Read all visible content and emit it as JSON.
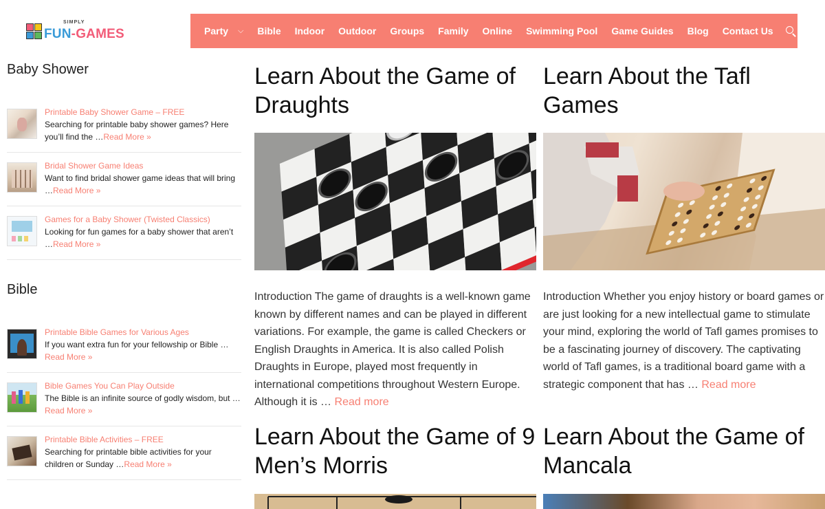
{
  "logo": {
    "simply": "SIMPLY",
    "fun": "FUN",
    "dash": "-",
    "games": "GAMES"
  },
  "nav": {
    "items": [
      "Party",
      "Bible",
      "Indoor",
      "Outdoor",
      "Groups",
      "Family",
      "Online",
      "Swimming Pool",
      "Game Guides",
      "Blog",
      "Contact Us"
    ],
    "party_chevron": "⌵",
    "search_icon": "search-icon",
    "bg_color": "#f77f72"
  },
  "sidebar": {
    "widgets": [
      {
        "title": "Baby Shower",
        "posts": [
          {
            "title": "Printable Baby Shower Game – FREE",
            "excerpt": "Searching for printable baby shower games? Here you’ll find the …",
            "more": "Read More »"
          },
          {
            "title": "Bridal Shower Game Ideas",
            "excerpt": "Want to find bridal shower game ideas that will bring …",
            "more": "Read More »"
          },
          {
            "title": "Games for a Baby Shower (Twisted Classics)",
            "excerpt": "Looking for fun games for a baby shower that aren’t …",
            "more": "Read More »"
          }
        ]
      },
      {
        "title": "Bible",
        "posts": [
          {
            "title": "Printable Bible Games for Various Ages",
            "excerpt": "If you want extra fun for your fellowship or Bible …",
            "more": "Read More »"
          },
          {
            "title": "Bible Games You Can Play Outside",
            "excerpt": "The Bible is an infinite source of godly wisdom, but …",
            "more": "Read More »"
          },
          {
            "title": "Printable Bible Activities – FREE",
            "excerpt": "Searching for printable bible activities for your children or Sunday …",
            "more": "Read More »"
          }
        ]
      }
    ]
  },
  "articles": [
    {
      "title": "Learn About the Game of Draughts",
      "excerpt": "Introduction The game of draughts is a well-known game known by different names and can be played in different variations. For example, the game is called Checkers or English Draughts in America. It is also called Polish Draughts in Europe, played most frequently in international competitions throughout Western Europe. Although it is …",
      "more": "Read more"
    },
    {
      "title": "Learn About the Tafl Games",
      "excerpt": "Introduction Whether you enjoy history or board games or are just looking for a new intellectual game to stimulate your mind, exploring the world of Tafl games promises to be a fascinating journey of discovery. The captivating world of Tafl games, is a traditional board game with a strategic component that has …",
      "more": "Read more"
    },
    {
      "title": "Learn About the Game of 9 Men’s Morris"
    },
    {
      "title": "Learn About the Game of Mancala"
    }
  ]
}
